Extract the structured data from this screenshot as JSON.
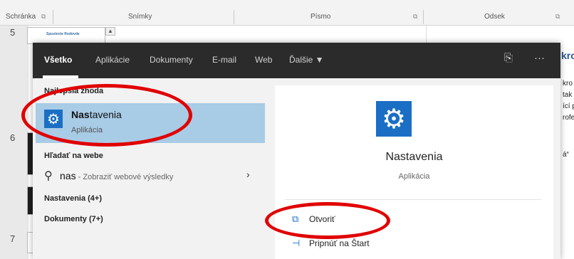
{
  "ribbon": {
    "groups": [
      "Schránka",
      "Snímky",
      "Písmo",
      "Odsek"
    ],
    "launcher_icon": "dialog-launcher-icon"
  },
  "slides": {
    "numbers": [
      "5",
      "6",
      "7"
    ],
    "thumb_title": "Spustenie Rodovde"
  },
  "document": {
    "heading_fragment": "kro",
    "lines": [
      "kro",
      "tak",
      "ící p",
      "rofe",
      "á“"
    ]
  },
  "search": {
    "tabs": [
      "Všetko",
      "Aplikácie",
      "Dokumenty",
      "E-mail",
      "Web",
      "Ďalšie ▼"
    ],
    "active_tab": "Všetko",
    "top_icons": [
      "feedback-icon",
      "more-icon"
    ],
    "more_label": "···",
    "best_match": {
      "header": "Najlepšia zhoda",
      "name_bold": "Nas",
      "name_rest": "tavenia",
      "type": "Aplikácia",
      "icon": "gear-icon"
    },
    "web": {
      "header": "Hľadať na webe",
      "query": "nas",
      "hint": " - Zobraziť webové výsledky"
    },
    "categories": [
      "Nastavenia (4+)",
      "Dokumenty (7+)"
    ],
    "preview": {
      "name": "Nastavenia",
      "type": "Aplikácia",
      "actions": [
        {
          "label": "Otvoriť",
          "icon": "open-icon"
        },
        {
          "label": "Pripnúť na Štart",
          "icon": "pin-icon"
        }
      ]
    }
  },
  "colors": {
    "accent": "#1a6fc4",
    "highlight": "#a8cbe6",
    "topbar": "#2b2b2b",
    "annotation": "#e00000"
  }
}
